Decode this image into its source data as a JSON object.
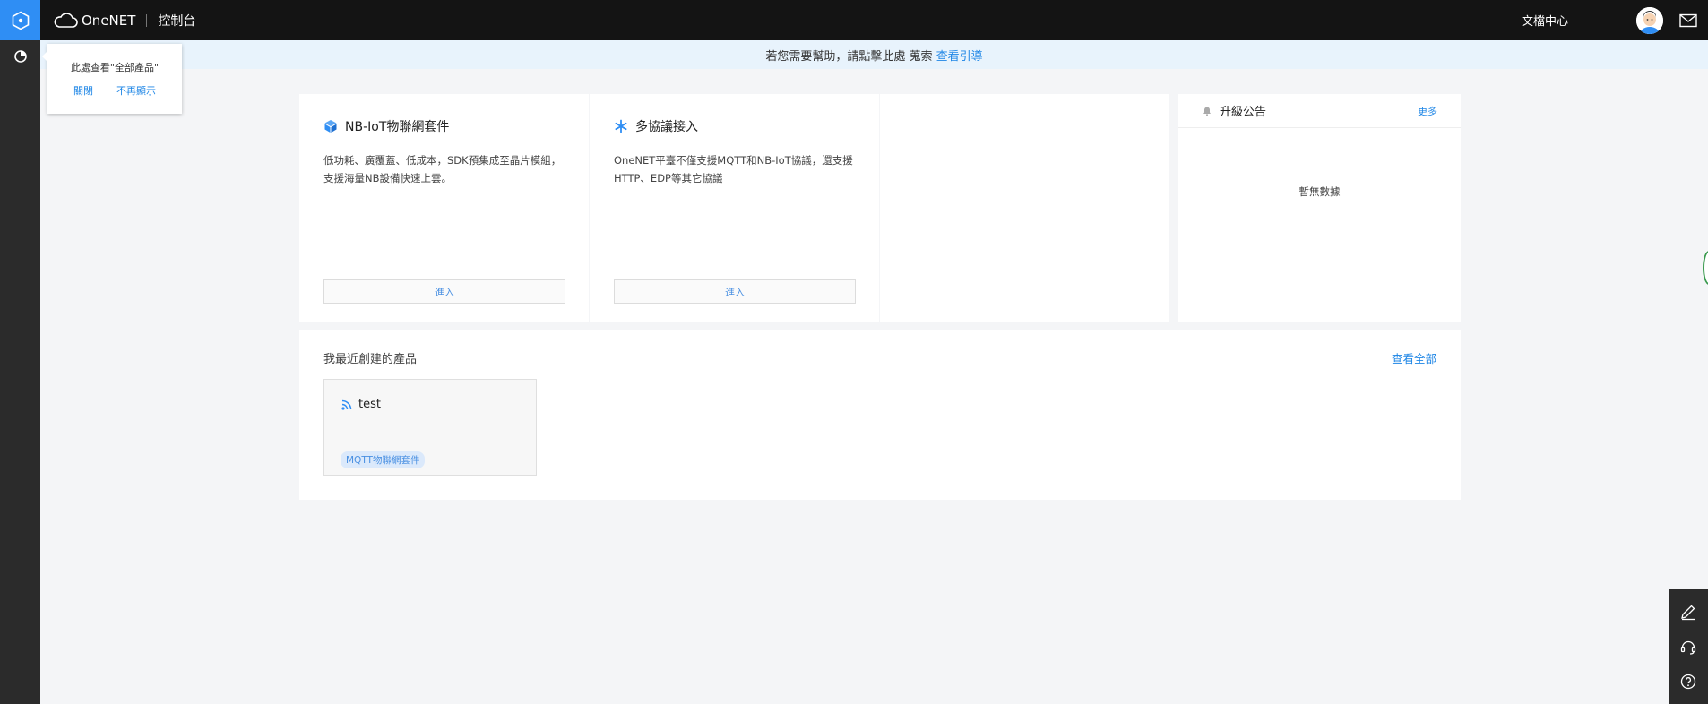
{
  "topbar": {
    "brand_name": "OneNET",
    "console_label": "控制台",
    "doc_center": "文檔中心"
  },
  "helpbar": {
    "text": "若您需要幫助，請點擊此處 蒐索",
    "guide_link": "查看引導"
  },
  "tip": {
    "text": "此處查看\"全部產品\"",
    "close_label": "關閉",
    "dont_show_label": "不再顯示"
  },
  "suites": [
    {
      "title": "NB-IoT物聯網套件",
      "icon": "cube-icon",
      "description": "低功耗、廣覆蓋、低成本，SDK預集成至晶片模組，支援海量NB設備快速上雲。",
      "enter_label": "進入"
    },
    {
      "title": "多協議接入",
      "icon": "asterisk-icon",
      "description": "OneNET平臺不僅支援MQTT和NB-IoT協議，還支援HTTP、EDP等其它協議",
      "enter_label": "進入"
    }
  ],
  "announcement": {
    "title": "升級公告",
    "more_label": "更多",
    "empty_text": "暫無數據"
  },
  "recent": {
    "title": "我最近創建的產品",
    "view_all": "查看全部",
    "products": [
      {
        "name": "test",
        "tag": "MQTT物聯網套件"
      }
    ]
  },
  "colors": {
    "accent": "#2f8ef4",
    "topbar": "#141414",
    "sidebar": "#2b2b2b",
    "link": "#1e86e6"
  }
}
